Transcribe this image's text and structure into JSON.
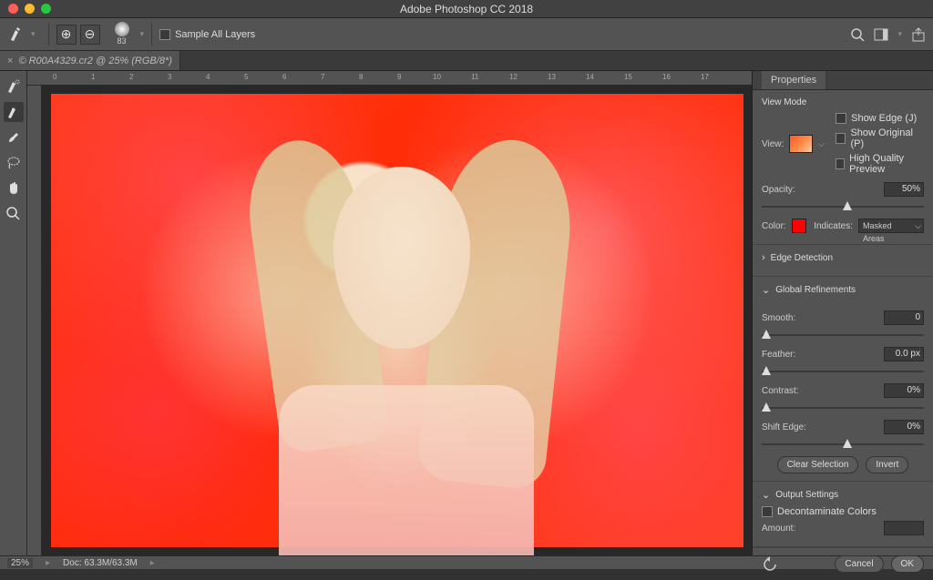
{
  "app_title": "Adobe Photoshop CC 2018",
  "options_bar": {
    "brush_size": "83",
    "sample_all_layers": "Sample All Layers"
  },
  "document": {
    "tab_label": "© R00A4329.cr2 @ 25% (RGB/8*)",
    "zoom": "25%",
    "doc_size": "Doc: 63.3M/63.3M"
  },
  "ruler_marks": [
    "0",
    "1",
    "2",
    "3",
    "4",
    "5",
    "6",
    "7",
    "8",
    "9",
    "10",
    "11",
    "12",
    "13",
    "14",
    "15",
    "16",
    "17"
  ],
  "panel": {
    "title": "Properties",
    "view_mode": {
      "section": "View Mode",
      "view_label": "View:",
      "show_edge": "Show Edge (J)",
      "show_original": "Show Original (P)",
      "hq_preview": "High Quality Preview",
      "opacity_label": "Opacity:",
      "opacity_value": "50%",
      "color_label": "Color:",
      "indicates_label": "Indicates:",
      "indicates_value": "Masked Areas"
    },
    "edge_detection": "Edge Detection",
    "global": {
      "section": "Global Refinements",
      "smooth_label": "Smooth:",
      "smooth_value": "0",
      "feather_label": "Feather:",
      "feather_value": "0.0 px",
      "contrast_label": "Contrast:",
      "contrast_value": "0%",
      "shift_label": "Shift Edge:",
      "shift_value": "0%",
      "clear_btn": "Clear Selection",
      "invert_btn": "Invert"
    },
    "output": {
      "section": "Output Settings",
      "decontaminate": "Decontaminate Colors",
      "amount_label": "Amount:"
    },
    "cancel": "Cancel",
    "ok": "OK"
  }
}
